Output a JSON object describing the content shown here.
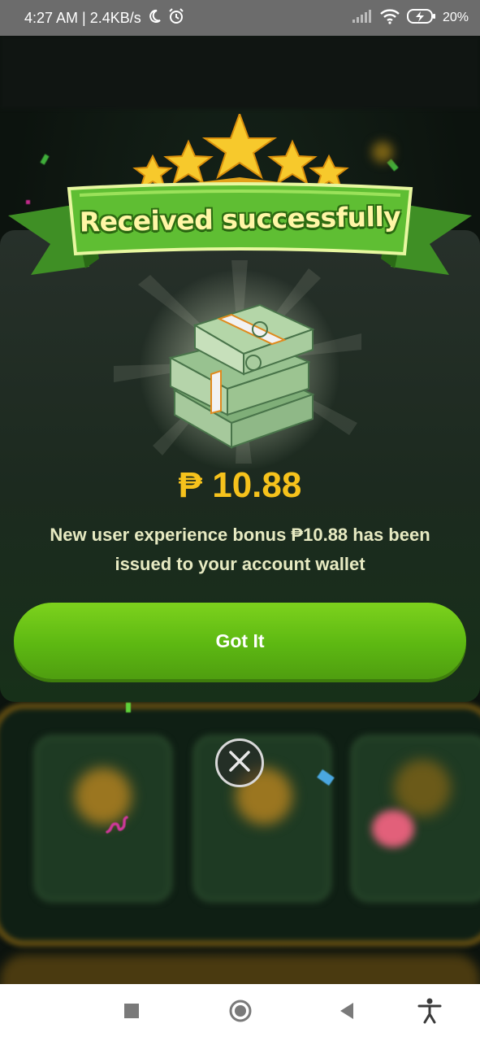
{
  "status_bar": {
    "time_speed": "4:27 AM | 2.4KB/s",
    "battery": "20%",
    "icons": [
      "moon-icon",
      "alarm-icon",
      "signal-icon",
      "wifi-icon",
      "battery-charging-icon"
    ]
  },
  "dialog": {
    "banner_title": "Received successfully",
    "amount": "₱ 10.88",
    "message": "New user experience bonus ₱10.88 has been issued to your account wallet",
    "button_label": "Got It"
  },
  "close": {
    "icon": "close-icon"
  },
  "nav_bar": {
    "icons": [
      "recents-square-icon",
      "home-circle-icon",
      "back-triangle-icon",
      "accessibility-icon"
    ]
  },
  "colors": {
    "accent_gold": "#f6c21c",
    "button_green": "#5db812",
    "message_text": "#e7eac2",
    "banner_green": "#4fae2a"
  }
}
